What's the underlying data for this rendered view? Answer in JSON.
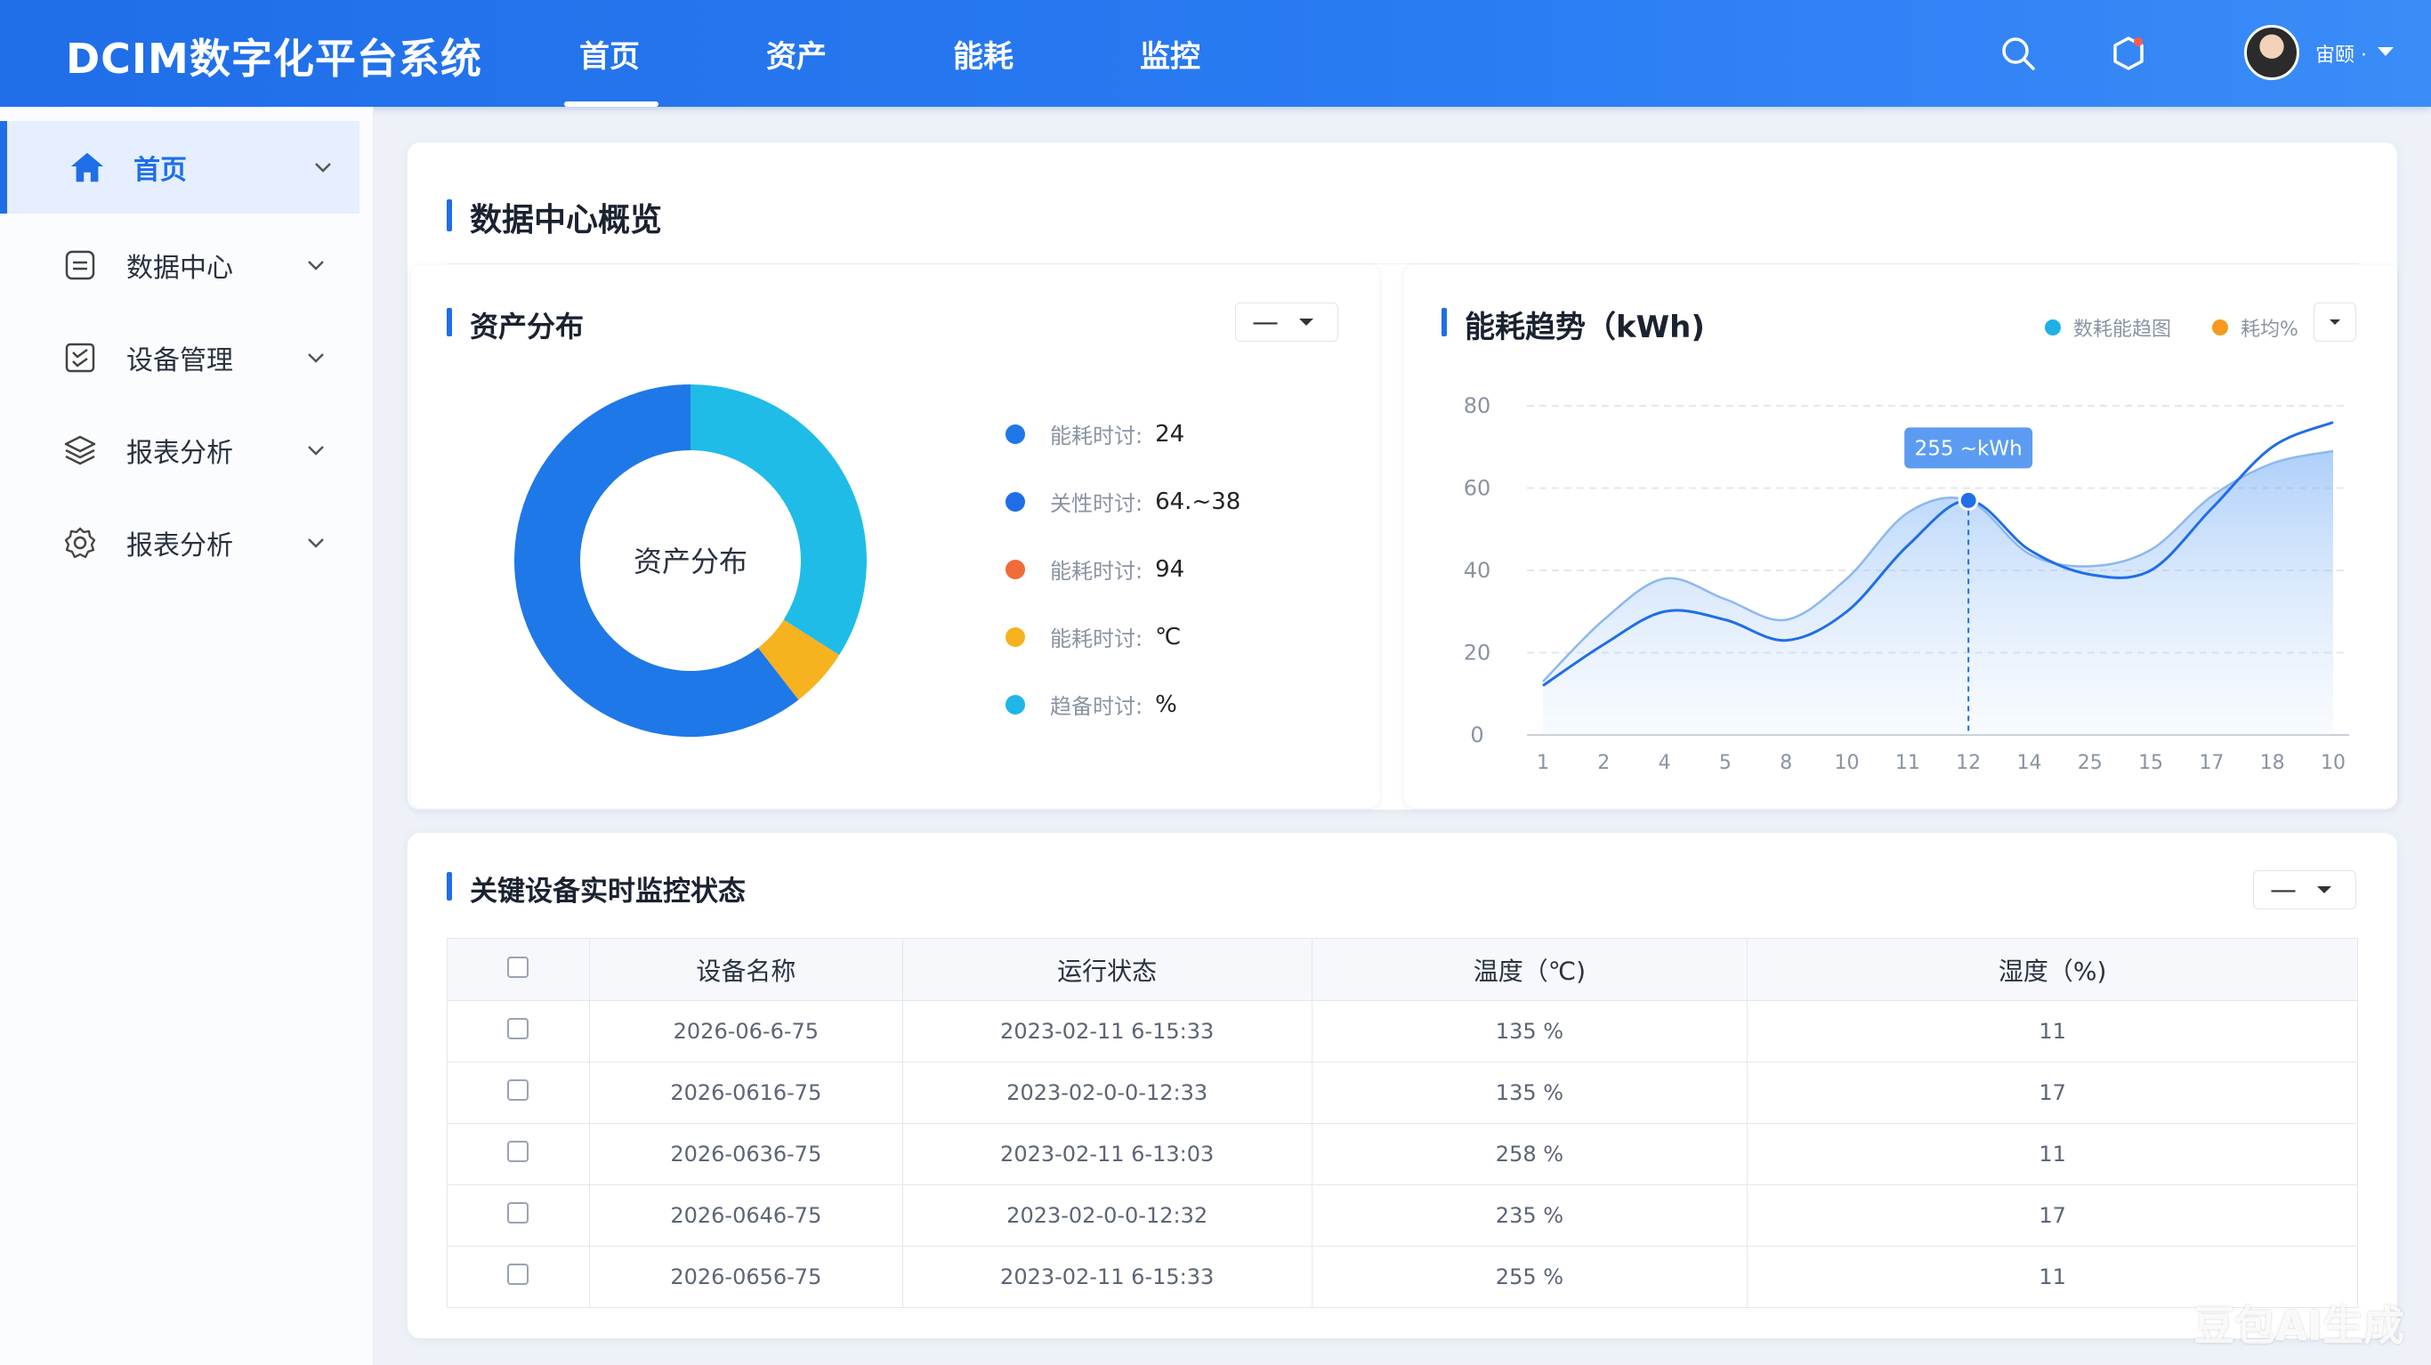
{
  "brand": "DCIM数字化平台系统",
  "nav": [
    {
      "label": "首页",
      "active": true
    },
    {
      "label": "资产",
      "active": false
    },
    {
      "label": "能耗",
      "active": false
    },
    {
      "label": "监控",
      "active": false
    }
  ],
  "header": {
    "icons": [
      "search-icon",
      "notification-icon"
    ],
    "user_name": "宙颐 ·"
  },
  "sidebar": {
    "items": [
      {
        "label": "首页",
        "icon": "home-icon",
        "active": true
      },
      {
        "label": "数据中心",
        "icon": "datacenter-icon",
        "active": false
      },
      {
        "label": "设备管理",
        "icon": "device-icon",
        "active": false
      },
      {
        "label": "报表分析",
        "icon": "report-icon",
        "active": false
      },
      {
        "label": "报表分析",
        "icon": "settings-icon",
        "active": false
      }
    ]
  },
  "overview": {
    "title": "数据中心概览"
  },
  "asset_card": {
    "title": "资产分布",
    "select_value": "—",
    "donut_center": "资产分布",
    "legend": [
      {
        "label": "能耗时讨:",
        "value": "24",
        "color": "#1f78e8"
      },
      {
        "label": "关性时讨:",
        "value": "64.~38",
        "color": "#1f6ee8"
      },
      {
        "label": "能耗时讨:",
        "value": "94",
        "color": "#f26b3a"
      },
      {
        "label": "能耗时讨:",
        "value": "℃",
        "color": "#f7b21f"
      },
      {
        "label": "趋备时讨:",
        "value": "%",
        "color": "#1fb6e8"
      }
    ]
  },
  "energy_card": {
    "title": "能耗趋势（kWh)",
    "legend": [
      {
        "label": "数耗能趋图",
        "color": "#1fb0e8"
      },
      {
        "label": "耗均%",
        "color": "#f59a1f"
      }
    ],
    "tooltip": "255 ~kWh"
  },
  "monitor_card": {
    "title": "关键设备实时监控状态",
    "select_value": "—",
    "columns": [
      "设备名称",
      "运行状态",
      "温度（℃)",
      "湿度（%)"
    ],
    "rows": [
      [
        "2026-06-6-75",
        "2023-02-11 6-15:33",
        "135 %",
        "11"
      ],
      [
        "2026-0616-75",
        "2023-02-0-0-12:33",
        "135 %",
        "17"
      ],
      [
        "2026-0636-75",
        "2023-02-11 6-13:03",
        "258 %",
        "11"
      ],
      [
        "2026-0646-75",
        "2023-02-0-0-12:32",
        "235 %",
        "17"
      ],
      [
        "2026-0656-75",
        "2023-02-11 6-15:33",
        "255 %",
        "11"
      ]
    ]
  },
  "chart_data": [
    {
      "type": "pie",
      "title": "资产分布",
      "labels": [
        "蓝色",
        "橙色",
        "青色"
      ],
      "values": [
        60.5,
        5.5,
        34
      ],
      "colors": [
        "#1f78e8",
        "#f7b21f",
        "#1fbce8"
      ]
    },
    {
      "type": "area",
      "title": "能耗趋势（kWh)",
      "categories": [
        "1",
        "2",
        "4",
        "5",
        "8",
        "10",
        "11",
        "12",
        "14",
        "25",
        "15",
        "17",
        "18",
        "10"
      ],
      "ylim": [
        0,
        80
      ],
      "yticks": [
        0,
        20,
        40,
        60,
        80
      ],
      "series": [
        {
          "name": "数耗能趋图",
          "values": [
            12,
            22,
            30,
            28,
            23,
            30,
            46,
            57,
            45,
            39,
            40,
            55,
            70,
            76
          ],
          "color": "#1f6ee8"
        },
        {
          "values": [
            13,
            28,
            38,
            33,
            28,
            38,
            54,
            57,
            44,
            41,
            45,
            58,
            66,
            69
          ],
          "color": "#8cb8f0"
        }
      ],
      "highlight_index": 7,
      "grid": true
    }
  ],
  "watermark": "豆包AI生成"
}
